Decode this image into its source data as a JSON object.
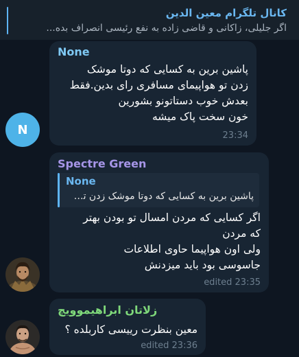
{
  "pinned": {
    "title": "کانال تلگرام معین الدین",
    "preview": "اگر جلیلی، زاکانی و قاضی زاده به نفع رئیسی انصراف بده..."
  },
  "messages": [
    {
      "sender": "None",
      "sender_color": "#7fc9f4",
      "avatar_letter": "N",
      "avatar_color": "#4eb3e8",
      "lines": [
        "پاشین برین به کسایی که دوتا موشک",
        "زدن تو هواپیمای مسافری رای بدین.فقط",
        "بعدش خوب دستاتونو بشورین",
        "خون سخت پاک میشه"
      ],
      "time": "23:34"
    },
    {
      "sender": "Spectre Green",
      "sender_color": "#a695e7",
      "avatar_icon": "warrior-avatar-icon",
      "reply": {
        "name": "None",
        "text": "پاشین برین به کسایی که دوتا موشک زدن تو..."
      },
      "lines": [
        "اگر کسایی که مردن امسال تو بودن بهتر",
        "که مردن",
        "ولی اون هواپیما حاوی اطلاعات",
        "جاسوسی بود باید میزدنش"
      ],
      "time": "edited 23:35"
    },
    {
      "sender": "زلاتان ابراهیموویچ",
      "sender_color": "#7fd87a",
      "avatar_icon": "athlete-avatar-icon",
      "lines": [
        "معین بنظرت رییسی کاربلده ؟"
      ],
      "time": "edited 23:36"
    }
  ]
}
